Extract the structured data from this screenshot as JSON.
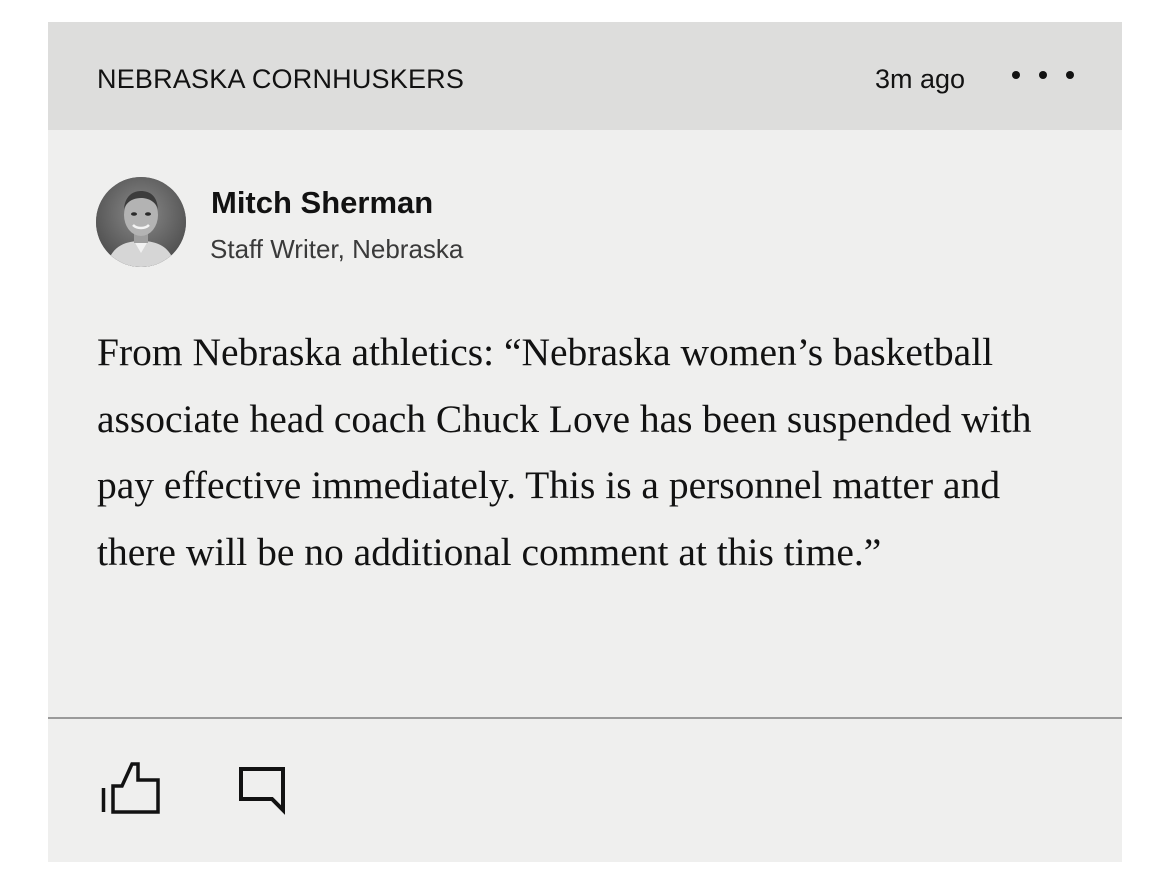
{
  "header": {
    "team": "NEBRASKA CORNHUSKERS",
    "time": "3m ago",
    "more_icon": "more-horizontal-icon"
  },
  "author": {
    "name": "Mitch Sherman",
    "role": "Staff Writer, Nebraska"
  },
  "post": {
    "text": "From Nebraska athletics: “Nebraska women’s basketball associate head coach Chuck Love has been suspended with pay effective immediately. This is a personnel matter and there will be no additional comment at this time.”"
  },
  "actions": {
    "like_icon": "thumbs-up-icon",
    "comment_icon": "comment-icon"
  },
  "colors": {
    "header_bg": "#dddddc",
    "card_bg": "#efefee",
    "text": "#121212",
    "divider": "#9a9a9a"
  }
}
